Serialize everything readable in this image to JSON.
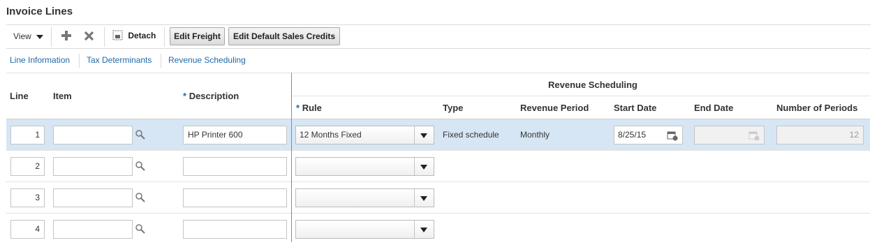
{
  "panel": {
    "title": "Invoice Lines"
  },
  "toolbar": {
    "view_label": "View",
    "detach_label": "Detach",
    "edit_freight_label": "Edit Freight",
    "edit_sales_credits_label": "Edit Default Sales Credits"
  },
  "tabs": [
    {
      "label": "Line Information"
    },
    {
      "label": "Tax Determinants"
    },
    {
      "label": "Revenue Scheduling"
    }
  ],
  "table": {
    "group_header": "Revenue Scheduling",
    "columns": {
      "line": "Line",
      "item": "Item",
      "description": "Description",
      "rule": "Rule",
      "type": "Type",
      "revenue_period": "Revenue Period",
      "start_date": "Start Date",
      "end_date": "End Date",
      "number_of_periods": "Number of Periods"
    },
    "rows": [
      {
        "line": "1",
        "item": "",
        "description": "HP Printer 600",
        "rule": "12 Months Fixed",
        "type": "Fixed schedule",
        "revenue_period": "Monthly",
        "start_date": "8/25/15",
        "end_date": "",
        "number_of_periods": "12"
      },
      {
        "line": "2",
        "item": "",
        "description": "",
        "rule": ""
      },
      {
        "line": "3",
        "item": "",
        "description": "",
        "rule": ""
      },
      {
        "line": "4",
        "item": "",
        "description": "",
        "rule": ""
      }
    ]
  },
  "colors": {
    "link": "#1f6aa8",
    "selected_row": "#d6e6f5",
    "required_marker": "#1f6aa8"
  },
  "icons": [
    "chevron-down-icon",
    "plus-icon",
    "delete-icon",
    "detach-icon",
    "search-icon",
    "calendar-icon"
  ]
}
